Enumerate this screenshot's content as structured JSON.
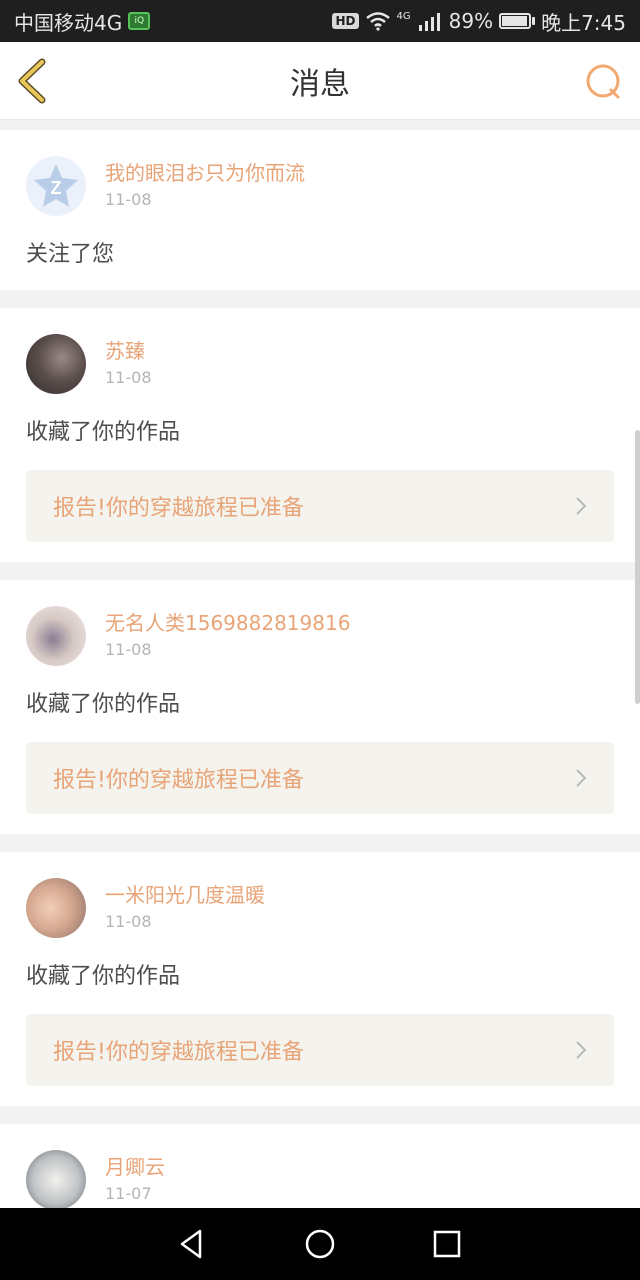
{
  "status_bar": {
    "carrier": "中国移动4G",
    "hd": "HD",
    "network": "4G",
    "battery_percent": "89%",
    "battery_level": 0.89,
    "time": "晚上7:45"
  },
  "header": {
    "title": "消息"
  },
  "messages": [
    {
      "username": "我的眼泪お只为你而流",
      "date": "11-08",
      "action": "关注了您",
      "report": null
    },
    {
      "username": "苏臻",
      "date": "11-08",
      "action": "收藏了你的作品",
      "report": "报告!你的穿越旅程已准备"
    },
    {
      "username": "无名人类1569882819816",
      "date": "11-08",
      "action": "收藏了你的作品",
      "report": "报告!你的穿越旅程已准备"
    },
    {
      "username": "一米阳光几度温暖",
      "date": "11-08",
      "action": "收藏了你的作品",
      "report": "报告!你的穿越旅程已准备"
    },
    {
      "username": "月卿云",
      "date": "11-07",
      "action": "",
      "report": null
    }
  ],
  "colors": {
    "accent": "#e8a477",
    "back_icon": "#e0b24a",
    "search_icon": "#f3a86f"
  },
  "icons": {
    "back": "chevron-left-icon",
    "search": "search-icon",
    "nav_back": "triangle-back-icon",
    "nav_home": "circle-home-icon",
    "nav_recent": "square-recent-icon"
  }
}
